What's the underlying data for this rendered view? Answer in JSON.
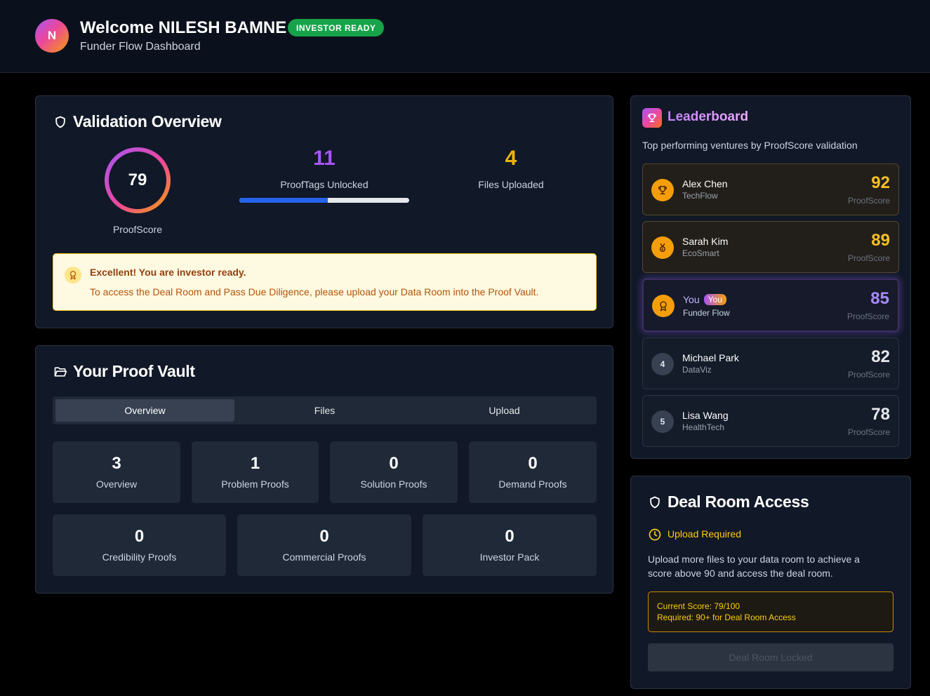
{
  "header": {
    "avatar_initial": "N",
    "welcome": "Welcome NILESH BAMNE",
    "badge": "INVESTOR READY",
    "subtitle": "Funder Flow Dashboard"
  },
  "validation": {
    "title": "Validation Overview",
    "proofscore": {
      "value": "79",
      "label": "ProofScore",
      "fraction": 0.79
    },
    "prooftags": {
      "value": "11",
      "label": "ProofTags Unlocked",
      "progress_fraction": 0.52
    },
    "files": {
      "value": "4",
      "label": "Files Uploaded"
    },
    "alert": {
      "title": "Excellent! You are investor ready.",
      "text": "To access the Deal Room and Pass Due Diligence, please upload your Data Room into the Proof Vault."
    }
  },
  "vault": {
    "title": "Your Proof Vault",
    "tabs": [
      {
        "label": "Overview",
        "active": true
      },
      {
        "label": "Files",
        "active": false
      },
      {
        "label": "Upload",
        "active": false
      }
    ],
    "tiles_row1": [
      {
        "value": "3",
        "label": "Overview"
      },
      {
        "value": "1",
        "label": "Problem Proofs"
      },
      {
        "value": "0",
        "label": "Solution Proofs"
      },
      {
        "value": "0",
        "label": "Demand Proofs"
      }
    ],
    "tiles_row2": [
      {
        "value": "0",
        "label": "Credibility Proofs"
      },
      {
        "value": "0",
        "label": "Commercial Proofs"
      },
      {
        "value": "0",
        "label": "Investor Pack"
      }
    ]
  },
  "leaderboard": {
    "title": "Leaderboard",
    "subtitle": "Top performing ventures by ProofScore validation",
    "score_label": "ProofScore",
    "entries": [
      {
        "name": "Alex Chen",
        "company": "TechFlow",
        "score": "92",
        "rank": "1",
        "icon": "trophy-icon"
      },
      {
        "name": "Sarah Kim",
        "company": "EcoSmart",
        "score": "89",
        "rank": "2",
        "icon": "medal-icon"
      },
      {
        "name": "You",
        "pill": "You",
        "company": "Funder Flow",
        "score": "85",
        "rank": "3",
        "icon": "award-icon"
      },
      {
        "name": "Michael Park",
        "company": "DataViz",
        "score": "82",
        "rank": "4"
      },
      {
        "name": "Lisa Wang",
        "company": "HealthTech",
        "score": "78",
        "rank": "5"
      }
    ]
  },
  "deal_room": {
    "title": "Deal Room Access",
    "status": "Upload Required",
    "text": "Upload more files to your data room to achieve a score above 90 and access the deal room.",
    "current_score": "Current Score: 79/100",
    "required": "Required: 90+ for Deal Room Access",
    "button": "Deal Room Locked"
  },
  "colors": {
    "accent_purple": "#a855f7",
    "accent_amber": "#eab308",
    "success_green": "#16a34a",
    "progress_blue": "#2563eb"
  }
}
